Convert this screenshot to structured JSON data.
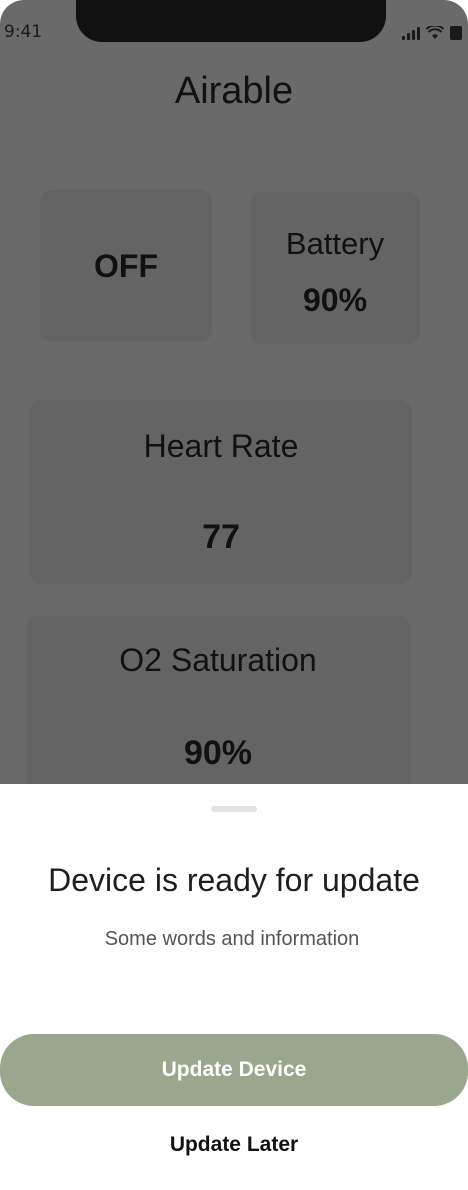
{
  "status_bar": {
    "time": "9:41",
    "icons": [
      "cellular-signal-icon",
      "wifi-icon",
      "battery-icon"
    ]
  },
  "app": {
    "title": "Airable",
    "power": {
      "value": "OFF"
    },
    "battery": {
      "label": "Battery",
      "value": "90%"
    },
    "heart_rate": {
      "label": "Heart Rate",
      "value": "77"
    },
    "o2_saturation": {
      "label": "O2 Saturation",
      "value": "90%"
    }
  },
  "sheet": {
    "title": "Device is ready for update",
    "subtitle": "Some words and information",
    "primary_button": "Update Device",
    "secondary_button": "Update Later"
  },
  "colors": {
    "overlay_dim": "#6a6a6a",
    "accent_button": "#9aa68e",
    "sheet_background": "#ffffff"
  }
}
